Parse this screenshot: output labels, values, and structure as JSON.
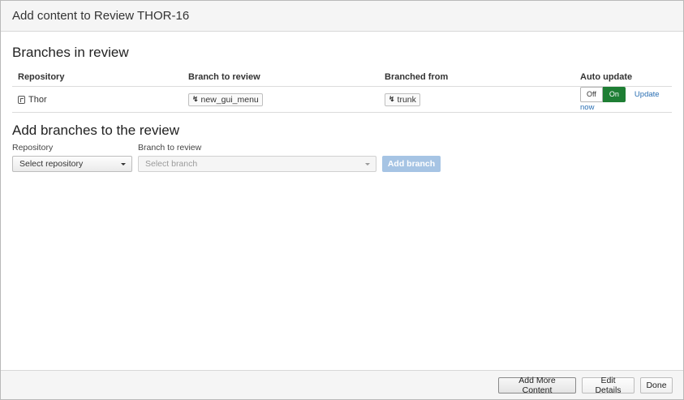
{
  "dialog": {
    "title": "Add content to Review THOR-16"
  },
  "branches_in_review": {
    "heading": "Branches in review",
    "columns": [
      "Repository",
      "Branch to review",
      "Branched from",
      "Auto update"
    ],
    "rows": [
      {
        "repository": "Thor",
        "branch": "new_gui_menu",
        "branched_from": "trunk",
        "auto_update": {
          "off_label": "Off",
          "on_label": "On",
          "state": "On"
        },
        "update_now": "Update now"
      }
    ]
  },
  "add_branches": {
    "heading": "Add branches to the review",
    "repository_label": "Repository",
    "repository_placeholder": "Select repository",
    "branch_label": "Branch to review",
    "branch_placeholder": "Select branch",
    "add_button": "Add branch"
  },
  "footer": {
    "add_more": "Add More Content",
    "edit_details": "Edit Details",
    "done": "Done"
  },
  "colors": {
    "toggle_on": "#1e7e34",
    "link": "#2a6fb3",
    "disabled_button": "#a6c4e4"
  },
  "icons": {
    "repository": "repository-icon",
    "branch": "branch-icon"
  }
}
